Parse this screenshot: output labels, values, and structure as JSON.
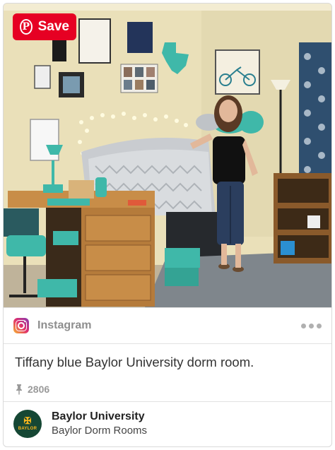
{
  "save_button": {
    "label": "Save",
    "icon": "pinterest-logo"
  },
  "source": {
    "icon": "instagram-icon",
    "name": "Instagram"
  },
  "pin": {
    "description": "Tiffany blue Baylor University dorm room.",
    "save_count": "2806",
    "save_count_icon": "pin-icon"
  },
  "board": {
    "owner": "Baylor University",
    "name": "Baylor Dorm Rooms",
    "avatar_wordmark": "BAYLOR"
  },
  "colors": {
    "save_red": "#e60023",
    "accent_teal": "#3fb8a9",
    "baylor_green": "#154734",
    "baylor_gold": "#ffb81c"
  },
  "photo": {
    "description_none": ""
  }
}
